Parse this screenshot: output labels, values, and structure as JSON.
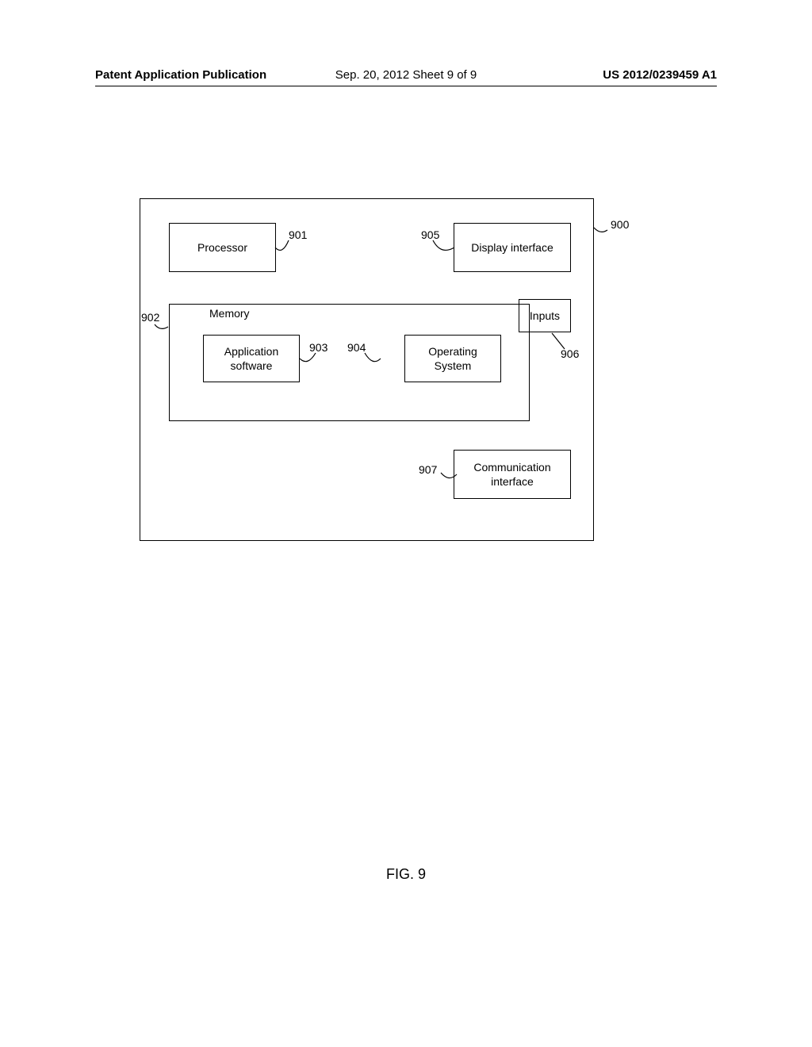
{
  "header": {
    "left": "Patent Application Publication",
    "center": "Sep. 20, 2012  Sheet 9 of 9",
    "right": "US 2012/0239459 A1"
  },
  "diagram": {
    "processor": "Processor",
    "display_interface": "Display interface",
    "memory": "Memory",
    "application_software": "Application\nsoftware",
    "operating_system": "Operating\nSystem",
    "inputs": "Inputs",
    "communication_interface": "Communication\ninterface"
  },
  "refs": {
    "r900": "900",
    "r901": "901",
    "r902": "902",
    "r903": "903",
    "r904": "904",
    "r905": "905",
    "r906": "906",
    "r907": "907"
  },
  "figure_label": "FIG. 9"
}
